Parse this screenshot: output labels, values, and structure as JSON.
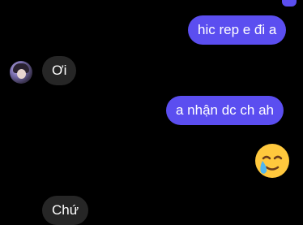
{
  "messages": {
    "m1": "hic rep e đi a",
    "m2": "Ơi",
    "m3": "a nhận dc ch ah",
    "m4": "Chứ"
  },
  "emoji_name": "face-holding-back-tears",
  "colors": {
    "outgoing": "#5b4ef0",
    "incoming": "#262626",
    "background": "#000000"
  }
}
